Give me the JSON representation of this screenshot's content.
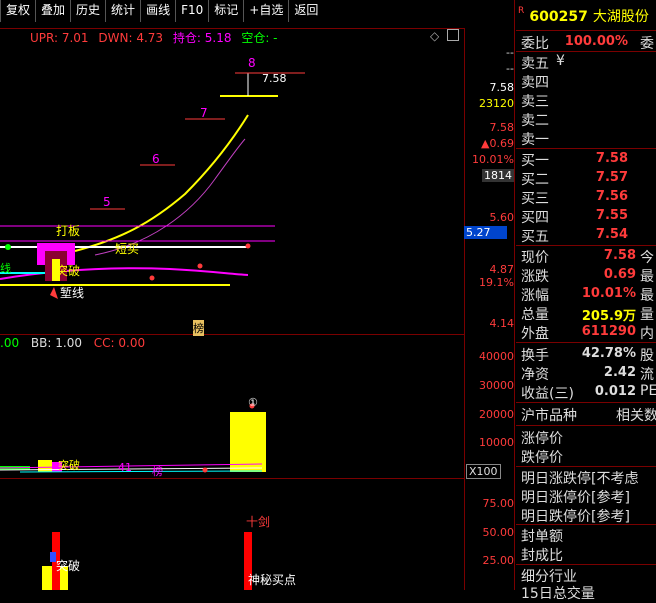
{
  "toolbar": [
    "复权",
    "叠加",
    "历史",
    "统计",
    "画线",
    "F10",
    "标记",
    "+自选",
    "返回"
  ],
  "header": {
    "upr": "UPR: 7.01",
    "dwn": "DWN: 4.73",
    "chicang": "持仓: 5.18",
    "kongcang": "空仓: -"
  },
  "price_axis": {
    "dash1": "--",
    "dash2": "--",
    "p758": "7.58",
    "vol": "23120",
    "p758b": "7.58",
    "chg": "▲0.69",
    "pct": "10.01%",
    "n1814": "1814",
    "p560": "5.60",
    "cur": "5.27",
    "p487": "4.87",
    "pct2": "19.1%",
    "p414": "4.14"
  },
  "main_labels": {
    "n8": "8",
    "n7": "7",
    "n6": "6",
    "n5": "5",
    "peak": "7.58",
    "daban": "打板",
    "duanmai": "短买",
    "xian": "线",
    "tupo": "突破",
    "qianxian": "堑线",
    "bang": "榜"
  },
  "sub1": {
    "bb": "BB: 1.00",
    "cc": "CC: 0.00",
    "left": ".00",
    "a40000": "40000",
    "a30000": "30000",
    "a20000": "20000",
    "a10000": "10000",
    "x100": "X100",
    "tupo": "突破",
    "w41": "41",
    "hao": "榜",
    "peak_label": "①"
  },
  "sub2": {
    "a75": "75.00",
    "a50": "50.00",
    "a25": "25.00",
    "shijian": "十剑",
    "tupo": "突破",
    "shenmi": "神秘买点"
  },
  "quote": {
    "code": "600257",
    "name": "大湖股份",
    "r_mark": "R",
    "weibi_label": "委比",
    "weibi_val": "100.00%",
    "weicha": "委",
    "sells": [
      {
        "label": "卖五",
        "extra": "¥"
      },
      {
        "label": "卖四",
        "extra": ""
      },
      {
        "label": "卖三",
        "extra": ""
      },
      {
        "label": "卖二",
        "extra": ""
      },
      {
        "label": "卖一",
        "extra": ""
      }
    ],
    "buys": [
      {
        "label": "买一",
        "value": "7.58"
      },
      {
        "label": "买二",
        "value": "7.57"
      },
      {
        "label": "买三",
        "value": "7.56"
      },
      {
        "label": "买四",
        "value": "7.55"
      },
      {
        "label": "买五",
        "value": "7.54"
      }
    ],
    "stats": [
      {
        "label": "现价",
        "value": "7.58",
        "color": "#ff3b3b",
        "extra": "今"
      },
      {
        "label": "涨跌",
        "value": "0.69",
        "color": "#ff3b3b",
        "extra": "最"
      },
      {
        "label": "涨幅",
        "value": "10.01%",
        "color": "#ff3b3b",
        "extra": "最"
      },
      {
        "label": "总量",
        "value": "205.9万",
        "color": "#ffff00",
        "extra": "量"
      },
      {
        "label": "外盘",
        "value": "611290",
        "color": "#ff3b3b",
        "extra": "内"
      }
    ],
    "stats2": [
      {
        "label": "换手",
        "value": "42.78%",
        "color": "#ddd",
        "extra": "股"
      },
      {
        "label": "净资",
        "value": "2.42",
        "color": "#ddd",
        "extra": "流"
      },
      {
        "label": "收益(三)",
        "value": "0.012",
        "color": "#ddd",
        "extra": "PE"
      }
    ],
    "tabs": [
      "沪市品种",
      "相关数"
    ],
    "limit": [
      "涨停价",
      "跌停价"
    ],
    "tomorrow": [
      "明日涨跌停[不考虑",
      "明日涨停价[参考]",
      "明日跌停价[参考]"
    ],
    "feng": [
      "封单额",
      "封成比"
    ],
    "industry": [
      "细分行业",
      "15日总交量"
    ]
  },
  "colors": {
    "red": "#ff3b3b",
    "yellow": "#ffff00",
    "magenta": "#ff00ff",
    "cyan": "#00ffff",
    "green": "#00ff00"
  }
}
